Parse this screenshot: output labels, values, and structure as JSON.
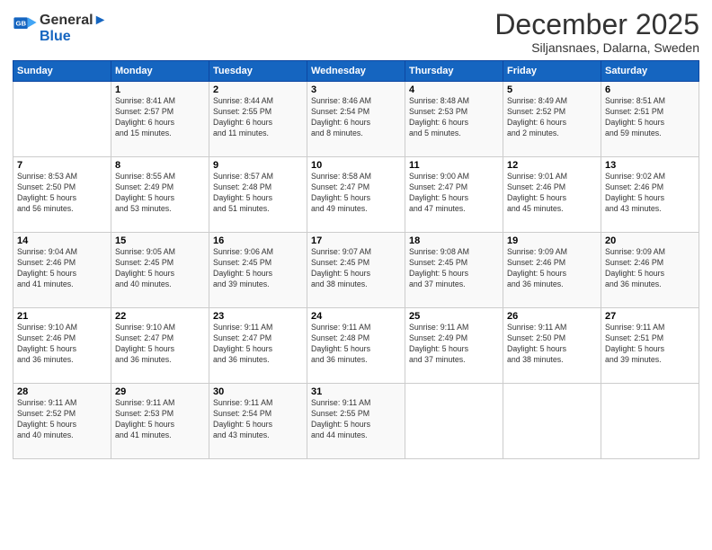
{
  "logo": {
    "line1": "General",
    "line2": "Blue"
  },
  "title": "December 2025",
  "subtitle": "Siljansnaes, Dalarna, Sweden",
  "days_of_week": [
    "Sunday",
    "Monday",
    "Tuesday",
    "Wednesday",
    "Thursday",
    "Friday",
    "Saturday"
  ],
  "weeks": [
    [
      {
        "day": "",
        "info": ""
      },
      {
        "day": "1",
        "info": "Sunrise: 8:41 AM\nSunset: 2:57 PM\nDaylight: 6 hours\nand 15 minutes."
      },
      {
        "day": "2",
        "info": "Sunrise: 8:44 AM\nSunset: 2:55 PM\nDaylight: 6 hours\nand 11 minutes."
      },
      {
        "day": "3",
        "info": "Sunrise: 8:46 AM\nSunset: 2:54 PM\nDaylight: 6 hours\nand 8 minutes."
      },
      {
        "day": "4",
        "info": "Sunrise: 8:48 AM\nSunset: 2:53 PM\nDaylight: 6 hours\nand 5 minutes."
      },
      {
        "day": "5",
        "info": "Sunrise: 8:49 AM\nSunset: 2:52 PM\nDaylight: 6 hours\nand 2 minutes."
      },
      {
        "day": "6",
        "info": "Sunrise: 8:51 AM\nSunset: 2:51 PM\nDaylight: 5 hours\nand 59 minutes."
      }
    ],
    [
      {
        "day": "7",
        "info": "Sunrise: 8:53 AM\nSunset: 2:50 PM\nDaylight: 5 hours\nand 56 minutes."
      },
      {
        "day": "8",
        "info": "Sunrise: 8:55 AM\nSunset: 2:49 PM\nDaylight: 5 hours\nand 53 minutes."
      },
      {
        "day": "9",
        "info": "Sunrise: 8:57 AM\nSunset: 2:48 PM\nDaylight: 5 hours\nand 51 minutes."
      },
      {
        "day": "10",
        "info": "Sunrise: 8:58 AM\nSunset: 2:47 PM\nDaylight: 5 hours\nand 49 minutes."
      },
      {
        "day": "11",
        "info": "Sunrise: 9:00 AM\nSunset: 2:47 PM\nDaylight: 5 hours\nand 47 minutes."
      },
      {
        "day": "12",
        "info": "Sunrise: 9:01 AM\nSunset: 2:46 PM\nDaylight: 5 hours\nand 45 minutes."
      },
      {
        "day": "13",
        "info": "Sunrise: 9:02 AM\nSunset: 2:46 PM\nDaylight: 5 hours\nand 43 minutes."
      }
    ],
    [
      {
        "day": "14",
        "info": "Sunrise: 9:04 AM\nSunset: 2:46 PM\nDaylight: 5 hours\nand 41 minutes."
      },
      {
        "day": "15",
        "info": "Sunrise: 9:05 AM\nSunset: 2:45 PM\nDaylight: 5 hours\nand 40 minutes."
      },
      {
        "day": "16",
        "info": "Sunrise: 9:06 AM\nSunset: 2:45 PM\nDaylight: 5 hours\nand 39 minutes."
      },
      {
        "day": "17",
        "info": "Sunrise: 9:07 AM\nSunset: 2:45 PM\nDaylight: 5 hours\nand 38 minutes."
      },
      {
        "day": "18",
        "info": "Sunrise: 9:08 AM\nSunset: 2:45 PM\nDaylight: 5 hours\nand 37 minutes."
      },
      {
        "day": "19",
        "info": "Sunrise: 9:09 AM\nSunset: 2:46 PM\nDaylight: 5 hours\nand 36 minutes."
      },
      {
        "day": "20",
        "info": "Sunrise: 9:09 AM\nSunset: 2:46 PM\nDaylight: 5 hours\nand 36 minutes."
      }
    ],
    [
      {
        "day": "21",
        "info": "Sunrise: 9:10 AM\nSunset: 2:46 PM\nDaylight: 5 hours\nand 36 minutes."
      },
      {
        "day": "22",
        "info": "Sunrise: 9:10 AM\nSunset: 2:47 PM\nDaylight: 5 hours\nand 36 minutes."
      },
      {
        "day": "23",
        "info": "Sunrise: 9:11 AM\nSunset: 2:47 PM\nDaylight: 5 hours\nand 36 minutes."
      },
      {
        "day": "24",
        "info": "Sunrise: 9:11 AM\nSunset: 2:48 PM\nDaylight: 5 hours\nand 36 minutes."
      },
      {
        "day": "25",
        "info": "Sunrise: 9:11 AM\nSunset: 2:49 PM\nDaylight: 5 hours\nand 37 minutes."
      },
      {
        "day": "26",
        "info": "Sunrise: 9:11 AM\nSunset: 2:50 PM\nDaylight: 5 hours\nand 38 minutes."
      },
      {
        "day": "27",
        "info": "Sunrise: 9:11 AM\nSunset: 2:51 PM\nDaylight: 5 hours\nand 39 minutes."
      }
    ],
    [
      {
        "day": "28",
        "info": "Sunrise: 9:11 AM\nSunset: 2:52 PM\nDaylight: 5 hours\nand 40 minutes."
      },
      {
        "day": "29",
        "info": "Sunrise: 9:11 AM\nSunset: 2:53 PM\nDaylight: 5 hours\nand 41 minutes."
      },
      {
        "day": "30",
        "info": "Sunrise: 9:11 AM\nSunset: 2:54 PM\nDaylight: 5 hours\nand 43 minutes."
      },
      {
        "day": "31",
        "info": "Sunrise: 9:11 AM\nSunset: 2:55 PM\nDaylight: 5 hours\nand 44 minutes."
      },
      {
        "day": "",
        "info": ""
      },
      {
        "day": "",
        "info": ""
      },
      {
        "day": "",
        "info": ""
      }
    ]
  ]
}
